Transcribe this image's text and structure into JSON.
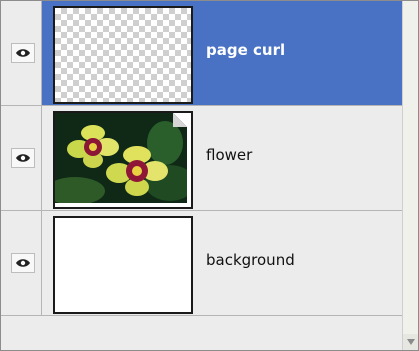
{
  "layers_panel": {
    "layers": [
      {
        "name": "page curl",
        "selected": true,
        "visible": true,
        "thumbnail": "transparent-checkerboard"
      },
      {
        "name": "flower",
        "selected": false,
        "visible": true,
        "thumbnail": "orchid-photo"
      },
      {
        "name": "background",
        "selected": false,
        "visible": true,
        "thumbnail": "white-fill"
      }
    ]
  },
  "icons": {
    "visibility": "eye-icon",
    "scroll_down": "arrow-down-icon"
  },
  "colors": {
    "selection": "#4a72c4",
    "panel": "#ececec",
    "divider": "#b5b5b5"
  }
}
